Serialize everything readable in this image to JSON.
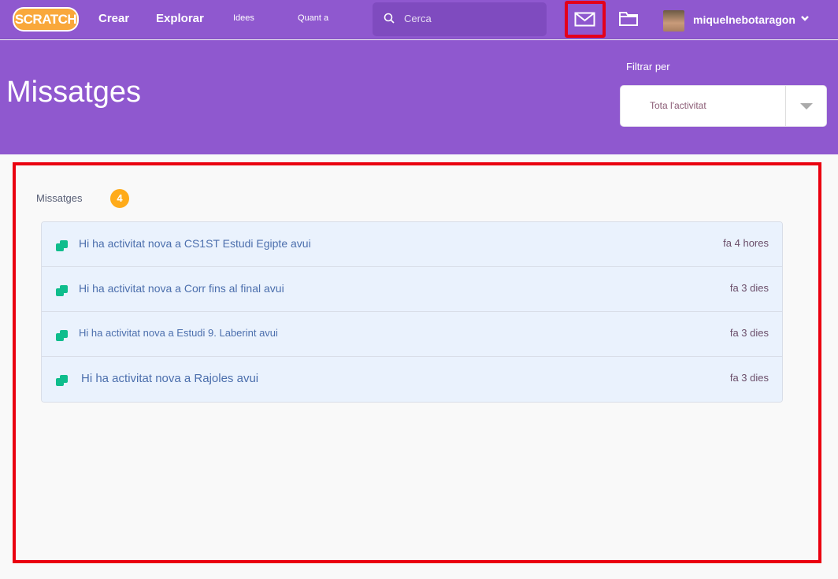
{
  "nav": {
    "logo": "SCRATCH",
    "links": [
      "Crear",
      "Explorar"
    ],
    "small_links": [
      "Idees",
      "Quant a"
    ],
    "search_placeholder": "Cerca",
    "username": "miquelnebotaragon"
  },
  "banner": {
    "title": "Missatges",
    "filter_label": "Filtrar per",
    "filter_value": "Tota l'activitat"
  },
  "messages": {
    "heading": "Missatges",
    "count": "4",
    "items": [
      {
        "text": "Hi ha activitat nova a CS1ST Estudi Egipte avui",
        "time": "fa 4 hores"
      },
      {
        "text": "Hi ha activitat nova a Corr fins al final avui",
        "time": "fa 3 dies"
      },
      {
        "text": "Hi ha activitat nova a Estudi 9. Laberint avui",
        "time": "fa 3 dies"
      },
      {
        "text": "Hi ha activitat nova a Rajoles avui",
        "time": "fa 3 dies"
      }
    ]
  },
  "colors": {
    "brand": "#8f58cf",
    "highlight": "#ea0010",
    "badge": "#ffab1a",
    "icon": "#0fbd8c"
  }
}
